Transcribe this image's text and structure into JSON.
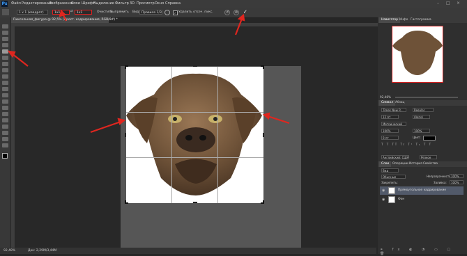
{
  "app": {
    "logo": "Ps"
  },
  "menu": [
    "Файл",
    "Редактирование",
    "Изображение",
    "Слои",
    "Шрифт",
    "Выделение",
    "Фильтр",
    "3D",
    "Просмотр",
    "Окно",
    "Справка"
  ],
  "options": {
    "ratio_label": "1 х 1 (квадрат)",
    "width_value": "1x1",
    "height_value": "1x1",
    "clear_label": "Очистить",
    "straighten_label": "Выпрямить",
    "view_label": "Вид:",
    "view_value": "Правило 1/3",
    "delete_cropped_label": "Удалить отсеч. пикс.",
    "confirm_symbol": "✓",
    "cancel_symbol": "⊘",
    "reset_symbol": "↺"
  },
  "document": {
    "tab_title": "Пиксельная_фигура @ 92,5% (Прост. кадрирования, RGB/8#) *"
  },
  "status": {
    "zoom": "92,48%",
    "doc_info": "Док: 2,29М/3,44М"
  },
  "panels": {
    "navigator_tabs": [
      "Навигатор",
      "Инфо",
      "Гистограмма"
    ],
    "navigator_zoom": "92,48%",
    "char_tabs": [
      "Символ",
      "Абзац"
    ],
    "font_family": "Times New R...",
    "font_style": "Regular",
    "antialias": "Метрический",
    "font_size": "12 пт",
    "leading": "(Авто)",
    "scale_v": "100%",
    "scale_h": "100%",
    "baseline": "0 пт",
    "color_label": "Цвет:",
    "aa_value": "Резкое",
    "lang_value": "Английский: США",
    "layers_tabs": [
      "Слои",
      "Операции",
      "История",
      "Свойства"
    ],
    "kind_label": "Вид",
    "blend_mode": "Обычные",
    "opacity_label": "Непрозрачность:",
    "opacity_value": "100%",
    "fill_label": "Заливка:",
    "fill_value": "100%",
    "lock_label": "Закрепить:",
    "layers": [
      {
        "name": "Прямоугольное кадрирование",
        "active": true
      },
      {
        "name": "Фон",
        "active": false
      }
    ]
  },
  "colors": {
    "accent_red": "#e02020",
    "arrow_red": "#e0261f"
  }
}
